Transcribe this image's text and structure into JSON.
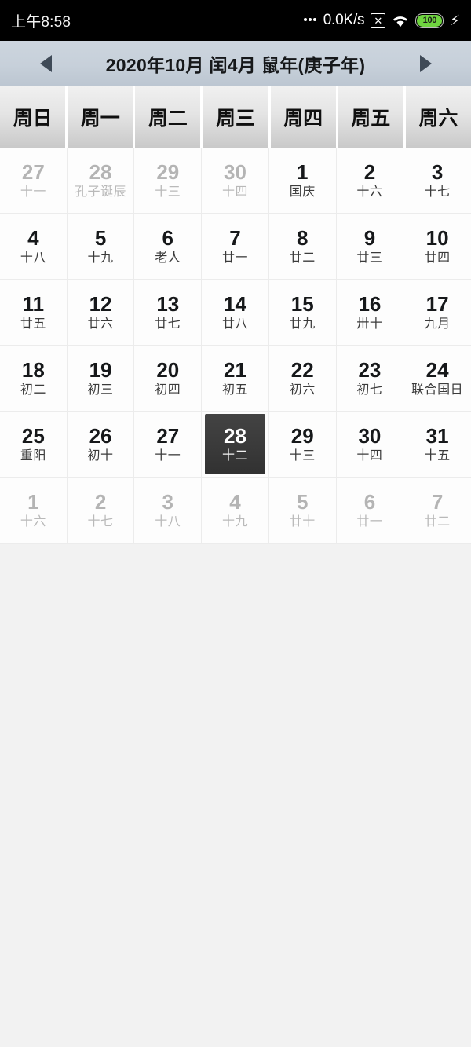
{
  "status_bar": {
    "time": "上午8:58",
    "network_speed": "0.0K/s",
    "no_sim_icon": "✕",
    "wifi_icon": "wifi-icon",
    "battery_level": "100",
    "battery_color": "#6fd43f",
    "charging_icon": "⚡"
  },
  "month_header": {
    "prev_label": "◀",
    "next_label": "▶",
    "title": "2020年10月 闰4月 鼠年(庚子年)"
  },
  "weekdays": [
    "周日",
    "周一",
    "周二",
    "周三",
    "周四",
    "周五",
    "周六"
  ],
  "selected_date": {
    "solar": "28",
    "lunar": "十二"
  },
  "accent_colors": {
    "header_bar": "#c7d0da",
    "selected_cell": "#3a3a3a",
    "current_month_text": "#16181a",
    "other_month_text": "#b4b4b4"
  },
  "days": [
    {
      "solar": "27",
      "lunar": "十一",
      "month": "prev",
      "selected": false
    },
    {
      "solar": "28",
      "lunar": "孔子诞辰",
      "month": "prev",
      "selected": false
    },
    {
      "solar": "29",
      "lunar": "十三",
      "month": "prev",
      "selected": false
    },
    {
      "solar": "30",
      "lunar": "十四",
      "month": "prev",
      "selected": false
    },
    {
      "solar": "1",
      "lunar": "国庆",
      "month": "current",
      "selected": false
    },
    {
      "solar": "2",
      "lunar": "十六",
      "month": "current",
      "selected": false
    },
    {
      "solar": "3",
      "lunar": "十七",
      "month": "current",
      "selected": false
    },
    {
      "solar": "4",
      "lunar": "十八",
      "month": "current",
      "selected": false
    },
    {
      "solar": "5",
      "lunar": "十九",
      "month": "current",
      "selected": false
    },
    {
      "solar": "6",
      "lunar": "老人",
      "month": "current",
      "selected": false
    },
    {
      "solar": "7",
      "lunar": "廿一",
      "month": "current",
      "selected": false
    },
    {
      "solar": "8",
      "lunar": "廿二",
      "month": "current",
      "selected": false
    },
    {
      "solar": "9",
      "lunar": "廿三",
      "month": "current",
      "selected": false
    },
    {
      "solar": "10",
      "lunar": "廿四",
      "month": "current",
      "selected": false
    },
    {
      "solar": "11",
      "lunar": "廿五",
      "month": "current",
      "selected": false
    },
    {
      "solar": "12",
      "lunar": "廿六",
      "month": "current",
      "selected": false
    },
    {
      "solar": "13",
      "lunar": "廿七",
      "month": "current",
      "selected": false
    },
    {
      "solar": "14",
      "lunar": "廿八",
      "month": "current",
      "selected": false
    },
    {
      "solar": "15",
      "lunar": "廿九",
      "month": "current",
      "selected": false
    },
    {
      "solar": "16",
      "lunar": "卅十",
      "month": "current",
      "selected": false
    },
    {
      "solar": "17",
      "lunar": "九月",
      "month": "current",
      "selected": false
    },
    {
      "solar": "18",
      "lunar": "初二",
      "month": "current",
      "selected": false
    },
    {
      "solar": "19",
      "lunar": "初三",
      "month": "current",
      "selected": false
    },
    {
      "solar": "20",
      "lunar": "初四",
      "month": "current",
      "selected": false
    },
    {
      "solar": "21",
      "lunar": "初五",
      "month": "current",
      "selected": false
    },
    {
      "solar": "22",
      "lunar": "初六",
      "month": "current",
      "selected": false
    },
    {
      "solar": "23",
      "lunar": "初七",
      "month": "current",
      "selected": false
    },
    {
      "solar": "24",
      "lunar": "联合国日",
      "month": "current",
      "selected": false
    },
    {
      "solar": "25",
      "lunar": "重阳",
      "month": "current",
      "selected": false
    },
    {
      "solar": "26",
      "lunar": "初十",
      "month": "current",
      "selected": false
    },
    {
      "solar": "27",
      "lunar": "十一",
      "month": "current",
      "selected": false
    },
    {
      "solar": "28",
      "lunar": "十二",
      "month": "current",
      "selected": true
    },
    {
      "solar": "29",
      "lunar": "十三",
      "month": "current",
      "selected": false
    },
    {
      "solar": "30",
      "lunar": "十四",
      "month": "current",
      "selected": false
    },
    {
      "solar": "31",
      "lunar": "十五",
      "month": "current",
      "selected": false
    },
    {
      "solar": "1",
      "lunar": "十六",
      "month": "next",
      "selected": false
    },
    {
      "solar": "2",
      "lunar": "十七",
      "month": "next",
      "selected": false
    },
    {
      "solar": "3",
      "lunar": "十八",
      "month": "next",
      "selected": false
    },
    {
      "solar": "4",
      "lunar": "十九",
      "month": "next",
      "selected": false
    },
    {
      "solar": "5",
      "lunar": "廿十",
      "month": "next",
      "selected": false
    },
    {
      "solar": "6",
      "lunar": "廿一",
      "month": "next",
      "selected": false
    },
    {
      "solar": "7",
      "lunar": "廿二",
      "month": "next",
      "selected": false
    }
  ]
}
